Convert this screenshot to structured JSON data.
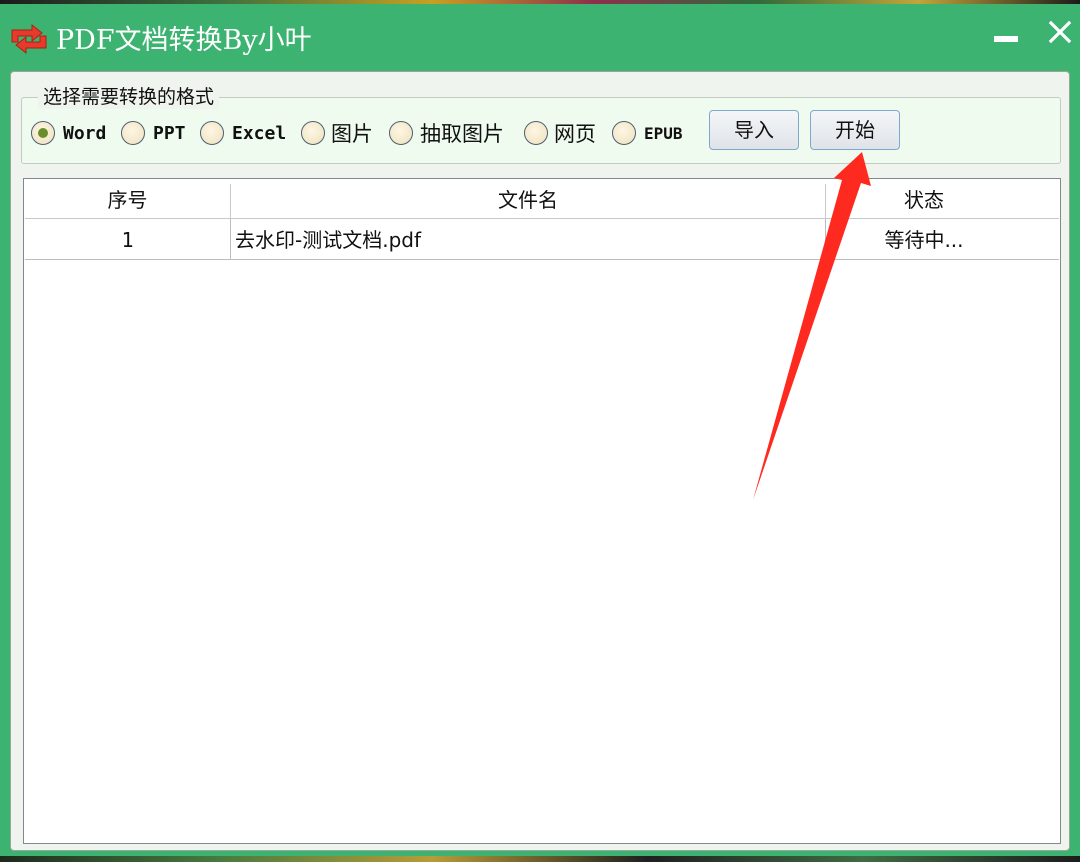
{
  "window": {
    "title": "PDF文档转换By小叶",
    "app_icon": "convert-arrows-icon",
    "title_bar_color": "#3cb371"
  },
  "format_group": {
    "legend": "选择需要转换的格式",
    "options": [
      {
        "label": "Word",
        "selected": true
      },
      {
        "label": "PPT",
        "selected": false
      },
      {
        "label": "Excel",
        "selected": false
      },
      {
        "label": "图片",
        "selected": false
      },
      {
        "label": "抽取图片",
        "selected": false
      },
      {
        "label": "网页",
        "selected": false
      },
      {
        "label": "EPUB",
        "selected": false
      }
    ],
    "buttons": {
      "import_label": "导入",
      "start_label": "开始"
    }
  },
  "file_table": {
    "columns": [
      "序号",
      "文件名",
      "状态"
    ],
    "rows": [
      {
        "index": "1",
        "filename": "去水印-测试文档.pdf",
        "status": "等待中..."
      }
    ]
  },
  "annotation": {
    "arrow_color": "#ff2a1f",
    "points_to": "start-button"
  }
}
